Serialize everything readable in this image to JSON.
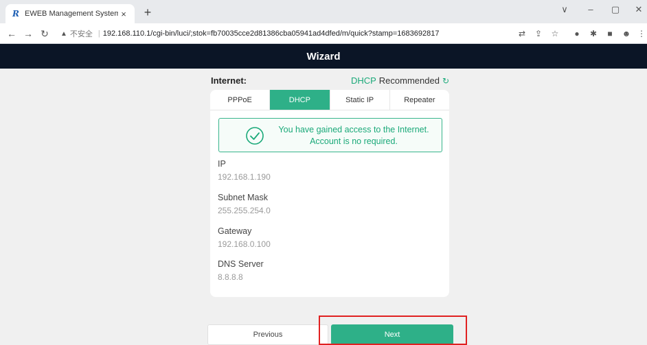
{
  "browser": {
    "tab_title": "EWEB Management System",
    "tab_close": "×",
    "new_tab": "+",
    "favicon": "R",
    "window_controls": [
      "∨",
      "–",
      "▢",
      "✕"
    ],
    "insecure_label": "不安全",
    "url": "192.168.110.1/cgi-bin/luci/;stok=fb70035cce2d81386cba05941ad4dfed/m/quick?stamp=1683692817"
  },
  "header": {
    "title": "Wizard"
  },
  "internet": {
    "label": "Internet:",
    "recommended_type": "DHCP",
    "recommended_text": "Recommended"
  },
  "tabs": [
    {
      "label": "PPPoE",
      "active": false
    },
    {
      "label": "DHCP",
      "active": true
    },
    {
      "label": "Static IP",
      "active": false
    },
    {
      "label": "Repeater",
      "active": false
    }
  ],
  "status": {
    "line1": "You have gained access to the Internet.",
    "line2": "Account is no required."
  },
  "fields": [
    {
      "label": "IP",
      "value": "192.168.1.190"
    },
    {
      "label": "Subnet Mask",
      "value": "255.255.254.0"
    },
    {
      "label": "Gateway",
      "value": "192.168.0.100"
    },
    {
      "label": "DNS Server",
      "value": "8.8.8.8"
    }
  ],
  "buttons": {
    "previous": "Previous",
    "next": "Next"
  },
  "colors": {
    "accent": "#2eb088",
    "header_bg": "#0b1526",
    "highlight": "#e02020"
  }
}
